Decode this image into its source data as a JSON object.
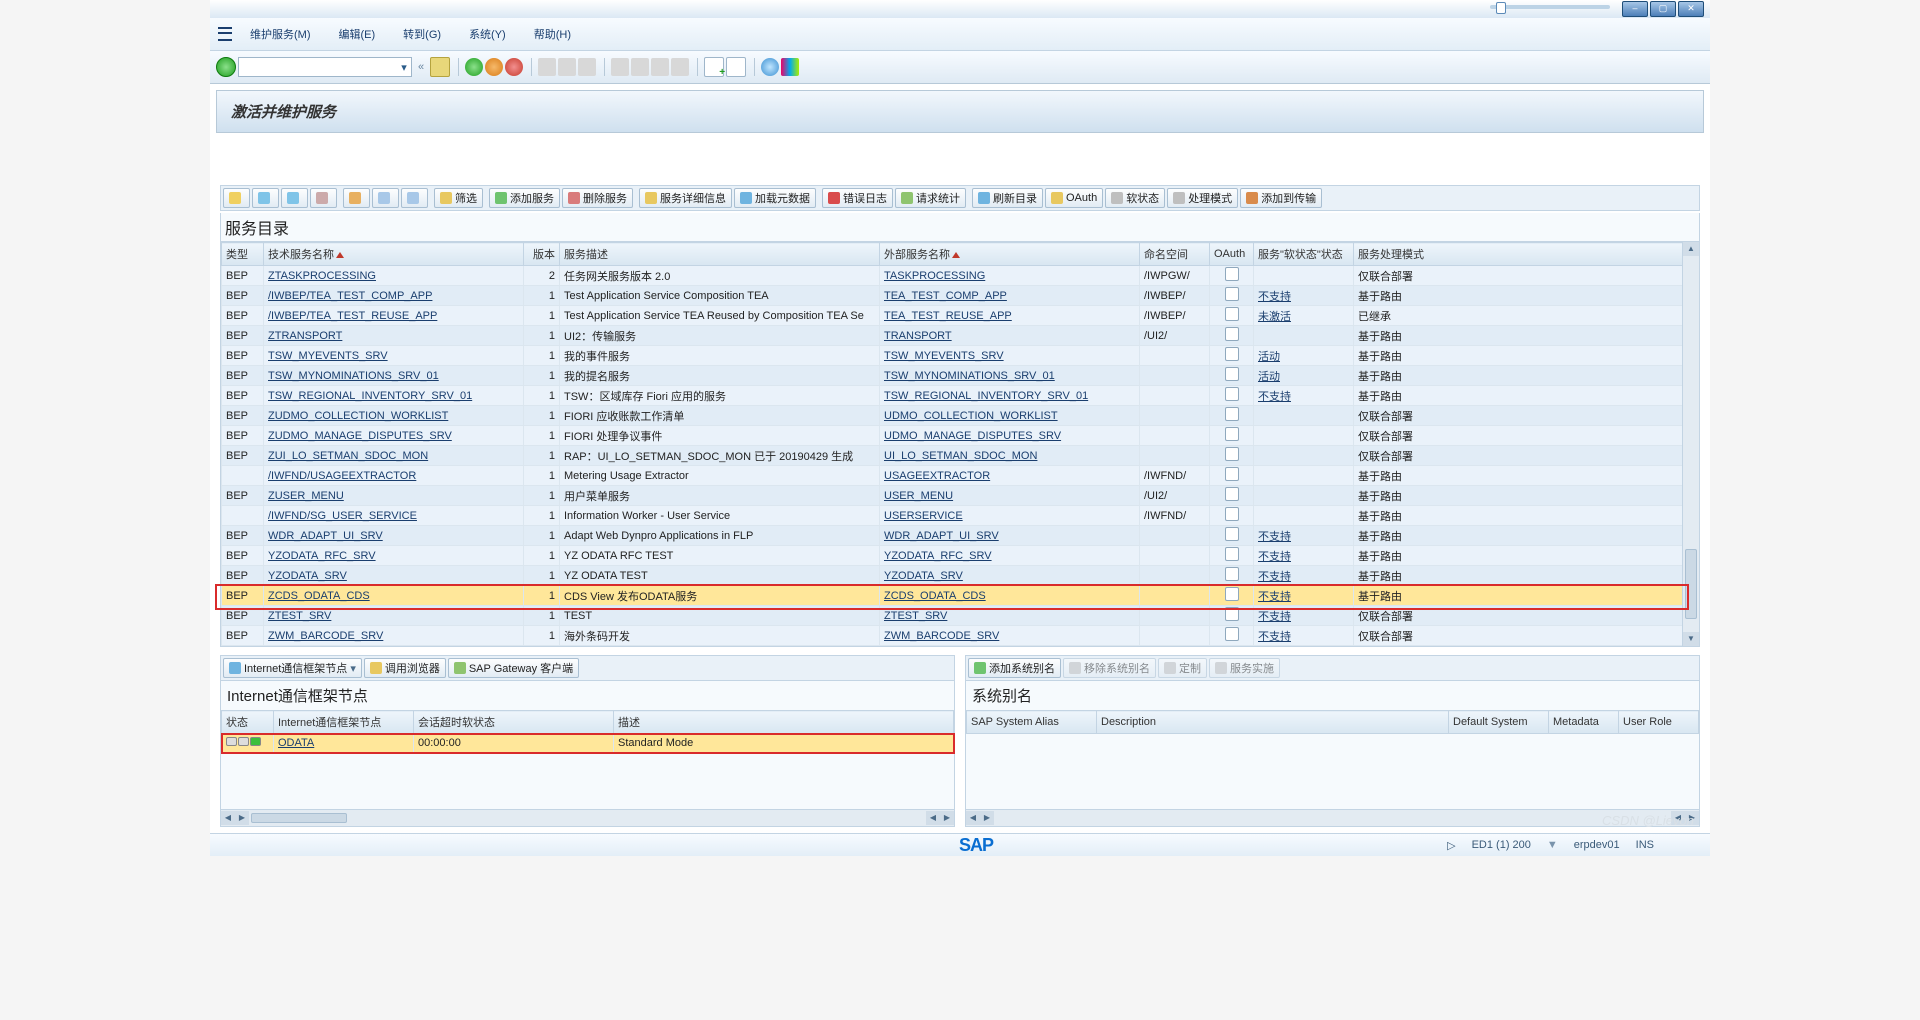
{
  "menu": {
    "items": [
      "维护服务(M)",
      "编辑(E)",
      "转到(G)",
      "系统(Y)",
      "帮助(H)"
    ]
  },
  "title": "激活并维护服务",
  "actionbar": [
    "筛选",
    "添加服务",
    "删除服务",
    "服务详细信息",
    "加载元数据",
    "错误日志",
    "请求统计",
    "刷新目录",
    "OAuth",
    "软状态",
    "处理模式",
    "添加到传输"
  ],
  "catalog_title": "服务目录",
  "columns": [
    "类型",
    "技术服务名称",
    "版本",
    "服务描述",
    "外部服务名称",
    "命名空间",
    "OAuth",
    "服务\"软状态\"状态",
    "服务处理模式"
  ],
  "rows": [
    {
      "t": "BEP",
      "tech": "ZTASKPROCESSING",
      "v": "2",
      "desc": "任务网关服务版本 2.0",
      "ext": "TASKPROCESSING",
      "ns": "/IWPGW/",
      "ss": "",
      "pm": "仅联合部署"
    },
    {
      "t": "BEP",
      "tech": "/IWBEP/TEA_TEST_COMP_APP",
      "v": "1",
      "desc": "Test Application Service Composition TEA",
      "ext": "TEA_TEST_COMP_APP",
      "ns": "/IWBEP/",
      "ss": "不支持",
      "pm": "基于路由"
    },
    {
      "t": "BEP",
      "tech": "/IWBEP/TEA_TEST_REUSE_APP",
      "v": "1",
      "desc": "Test Application Service TEA Reused by Composition TEA Se",
      "ext": "TEA_TEST_REUSE_APP",
      "ns": "/IWBEP/",
      "ss": "未激活",
      "pm": "已继承"
    },
    {
      "t": "BEP",
      "tech": "ZTRANSPORT",
      "v": "1",
      "desc": "UI2：传输服务",
      "ext": "TRANSPORT",
      "ns": "/UI2/",
      "ss": "",
      "pm": "基于路由"
    },
    {
      "t": "BEP",
      "tech": "TSW_MYEVENTS_SRV",
      "v": "1",
      "desc": "我的事件服务",
      "ext": "TSW_MYEVENTS_SRV",
      "ns": "",
      "ss": "活动",
      "pm": "基于路由"
    },
    {
      "t": "BEP",
      "tech": "TSW_MYNOMINATIONS_SRV_01",
      "v": "1",
      "desc": "我的提名服务",
      "ext": "TSW_MYNOMINATIONS_SRV_01",
      "ns": "",
      "ss": "活动",
      "pm": "基于路由"
    },
    {
      "t": "BEP",
      "tech": "TSW_REGIONAL_INVENTORY_SRV_01",
      "v": "1",
      "desc": "TSW：区域库存 Fiori 应用的服务",
      "ext": "TSW_REGIONAL_INVENTORY_SRV_01",
      "ns": "",
      "ss": "不支持",
      "pm": "基于路由"
    },
    {
      "t": "BEP",
      "tech": "ZUDMO_COLLECTION_WORKLIST",
      "v": "1",
      "desc": "FIORI 应收账款工作清单",
      "ext": "UDMO_COLLECTION_WORKLIST",
      "ns": "",
      "ss": "",
      "pm": "仅联合部署"
    },
    {
      "t": "BEP",
      "tech": "ZUDMO_MANAGE_DISPUTES_SRV",
      "v": "1",
      "desc": "FIORI 处理争议事件",
      "ext": "UDMO_MANAGE_DISPUTES_SRV",
      "ns": "",
      "ss": "",
      "pm": "仅联合部署"
    },
    {
      "t": "BEP",
      "tech": "ZUI_LO_SETMAN_SDOC_MON",
      "v": "1",
      "desc": "RAP：UI_LO_SETMAN_SDOC_MON 已于 20190429 生成",
      "ext": "UI_LO_SETMAN_SDOC_MON",
      "ns": "",
      "ss": "",
      "pm": "仅联合部署"
    },
    {
      "t": "",
      "tech": "/IWFND/USAGEEXTRACTOR",
      "v": "1",
      "desc": "Metering Usage Extractor",
      "ext": "USAGEEXTRACTOR",
      "ns": "/IWFND/",
      "ss": "",
      "pm": "基于路由"
    },
    {
      "t": "BEP",
      "tech": "ZUSER_MENU",
      "v": "1",
      "desc": "用户菜单服务",
      "ext": "USER_MENU",
      "ns": "/UI2/",
      "ss": "",
      "pm": "基于路由"
    },
    {
      "t": "",
      "tech": "/IWFND/SG_USER_SERVICE",
      "v": "1",
      "desc": "Information Worker - User Service",
      "ext": "USERSERVICE",
      "ns": "/IWFND/",
      "ss": "",
      "pm": "基于路由"
    },
    {
      "t": "BEP",
      "tech": "WDR_ADAPT_UI_SRV",
      "v": "1",
      "desc": "Adapt Web Dynpro Applications in FLP",
      "ext": "WDR_ADAPT_UI_SRV",
      "ns": "",
      "ss": "不支持",
      "pm": "基于路由"
    },
    {
      "t": "BEP",
      "tech": "YZODATA_RFC_SRV",
      "v": "1",
      "desc": "YZ ODATA RFC TEST",
      "ext": "YZODATA_RFC_SRV",
      "ns": "",
      "ss": "不支持",
      "pm": "基于路由"
    },
    {
      "t": "BEP",
      "tech": "YZODATA_SRV",
      "v": "1",
      "desc": "YZ ODATA TEST",
      "ext": "YZODATA_SRV",
      "ns": "",
      "ss": "不支持",
      "pm": "基于路由"
    },
    {
      "t": "BEP",
      "tech": "ZCDS_ODATA_CDS",
      "v": "1",
      "desc": "CDS View 发布ODATA服务",
      "ext": "ZCDS_ODATA_CDS",
      "ns": "",
      "ss": "不支持",
      "pm": "基于路由",
      "hl": true
    },
    {
      "t": "BEP",
      "tech": "ZTEST_SRV",
      "v": "1",
      "desc": "TEST",
      "ext": "ZTEST_SRV",
      "ns": "",
      "ss": "不支持",
      "pm": "仅联合部署"
    },
    {
      "t": "BEP",
      "tech": "ZWM_BARCODE_SRV",
      "v": "1",
      "desc": "海外条码开发",
      "ext": "ZWM_BARCODE_SRV",
      "ns": "",
      "ss": "不支持",
      "pm": "仅联合部署"
    }
  ],
  "left_panel": {
    "buttons": [
      "Internet通信框架节点",
      "调用浏览器",
      "SAP Gateway 客户端"
    ],
    "title": "Internet通信框架节点",
    "cols": [
      "状态",
      "Internet通信框架节点",
      "会话超时软状态",
      "描述"
    ],
    "row": {
      "node": "ODATA",
      "timeout": "00:00:00",
      "desc": "Standard Mode"
    }
  },
  "right_panel": {
    "buttons": [
      "添加系统别名",
      "移除系统别名",
      "定制",
      "服务实施"
    ],
    "title": "系统别名",
    "cols": [
      "SAP System Alias",
      "Description",
      "Default System",
      "Metadata",
      "User Role"
    ]
  },
  "status": {
    "sys": "ED1 (1) 200",
    "host": "erpdev01",
    "mode": "INS"
  },
  "watermark": "CSDN @Lievon"
}
